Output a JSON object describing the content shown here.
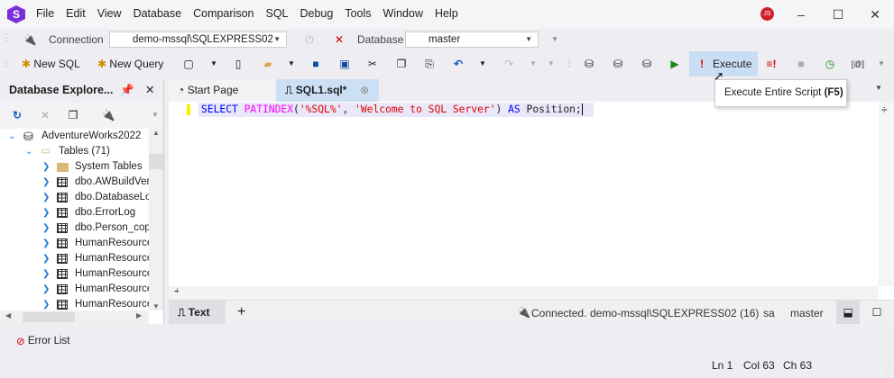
{
  "app": {
    "logo": "S",
    "menu": [
      "File",
      "Edit",
      "View",
      "Database",
      "Comparison",
      "SQL",
      "Debug",
      "Tools",
      "Window",
      "Help"
    ],
    "avatar": "JS"
  },
  "connection_bar": {
    "connection_label": "Connection",
    "connection_value": "demo-mssql\\SQLEXPRESS02",
    "database_label": "Database",
    "database_value": "master"
  },
  "toolbar": {
    "new_sql": "New SQL",
    "new_query": "New Query",
    "execute": "Execute"
  },
  "tooltip": {
    "text": "Execute Entire Script ",
    "shortcut": "(F5)"
  },
  "explorer": {
    "title": "Database Explore...",
    "root": "AdventureWorks2022",
    "tables": "Tables (71)",
    "items": [
      "System Tables",
      "dbo.AWBuildVers",
      "dbo.DatabaseLog",
      "dbo.ErrorLog",
      "dbo.Person_copy",
      "HumanResources",
      "HumanResources",
      "HumanResources",
      "HumanResources",
      "HumanResources"
    ]
  },
  "tabs": [
    {
      "label": "Start Page"
    },
    {
      "label": "SQL1.sql*"
    }
  ],
  "editor": {
    "code": [
      {
        "t": "SELECT ",
        "c": "kw"
      },
      {
        "t": "PATINDEX",
        "c": "fn"
      },
      {
        "t": "(",
        "c": ""
      },
      {
        "t": "'%SQL%'",
        "c": "str"
      },
      {
        "t": ", ",
        "c": ""
      },
      {
        "t": "'Welcome to SQL Server'",
        "c": "str"
      },
      {
        "t": ") ",
        "c": ""
      },
      {
        "t": "AS",
        "c": "kw"
      },
      {
        "t": " Position;",
        "c": ""
      }
    ]
  },
  "result_bar": {
    "text_tab": "Text",
    "add": "+",
    "status": "Connected.",
    "server": "demo-mssql\\SQLEXPRESS02 (16)",
    "user": "sa",
    "database": "master"
  },
  "error_list": "Error List",
  "statusbar": {
    "ln": "Ln 1",
    "col": "Col 63",
    "ch": "Ch 63"
  },
  "colors": {
    "accent": "#7b2fd6",
    "selected_tab": "#cce0f5",
    "execute_highlight": "#c9def5",
    "line_highlight": "#e8e8f8"
  }
}
